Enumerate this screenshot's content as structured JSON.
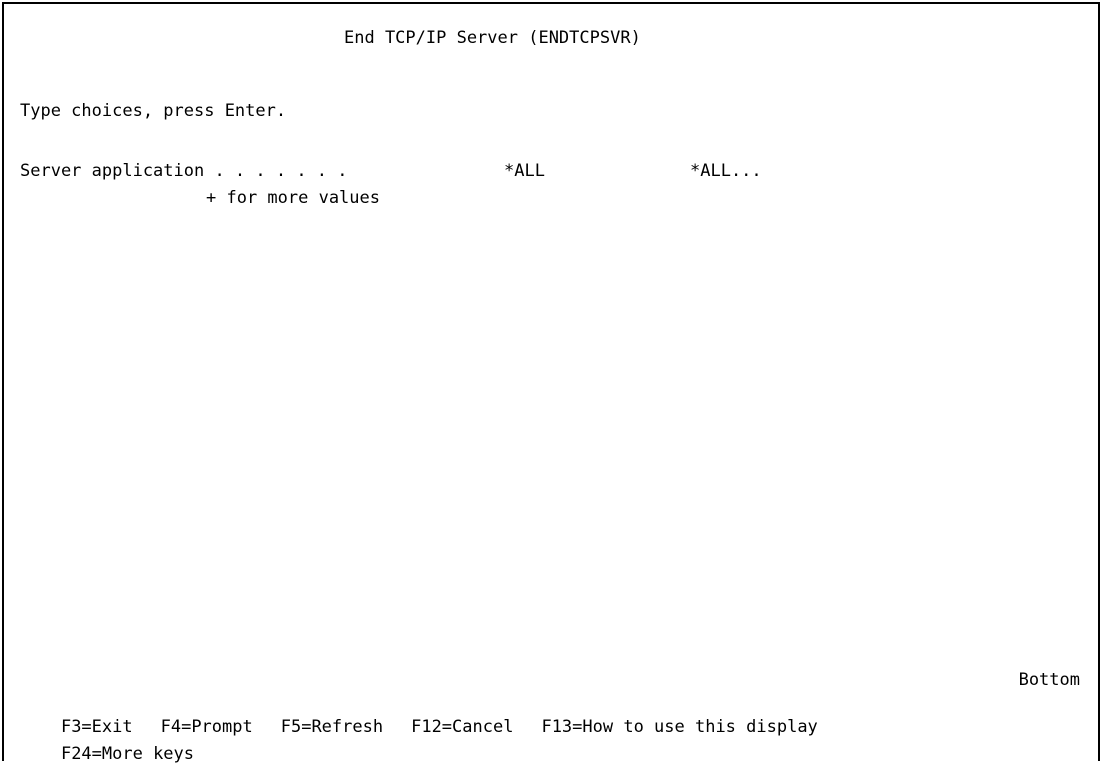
{
  "screen": {
    "title": "End TCP/IP Server (ENDTCPSVR)",
    "instruction": "Type choices, press Enter.",
    "field": {
      "label": "Server application . . . . . . .",
      "value": "*ALL",
      "allowed_values_hint": "*ALL...",
      "more_values_hint": "+ for more values"
    },
    "position_indicator": "Bottom",
    "function_keys": [
      {
        "key": "F3",
        "label": "F3=Exit"
      },
      {
        "key": "F4",
        "label": "F4=Prompt"
      },
      {
        "key": "F5",
        "label": "F5=Refresh"
      },
      {
        "key": "F12",
        "label": "F12=Cancel"
      },
      {
        "key": "F13",
        "label": "F13=How to use this display"
      },
      {
        "key": "F24",
        "label": "F24=More keys"
      }
    ]
  }
}
